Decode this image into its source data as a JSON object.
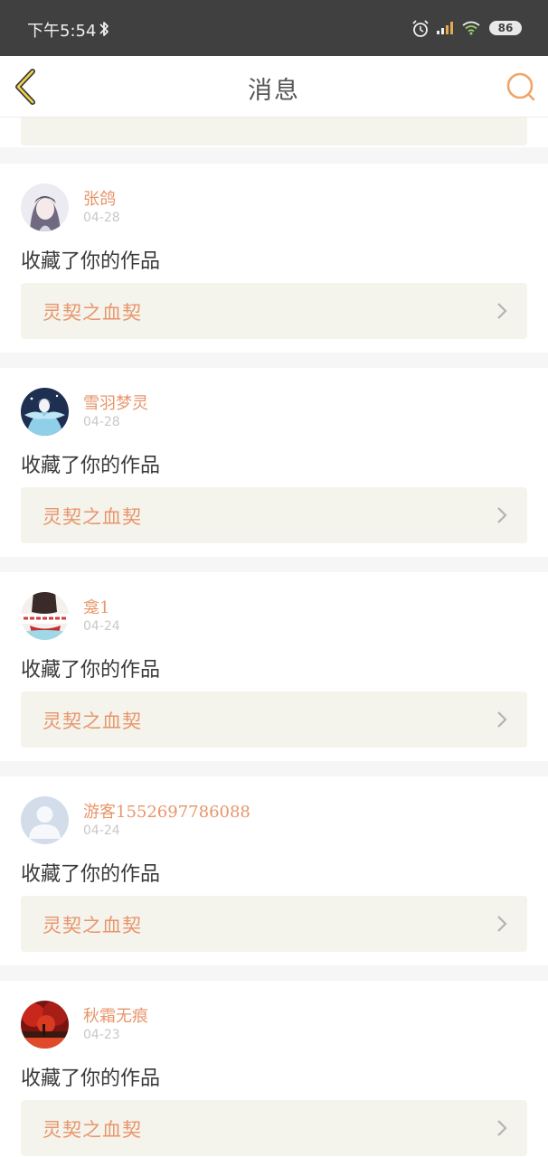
{
  "status_bar": {
    "time": "下午5:54",
    "battery": "86"
  },
  "nav": {
    "title": "消息"
  },
  "messages": [
    {
      "user": "张鸽",
      "date": "04-28",
      "action": "收藏了你的作品",
      "work": "灵契之血契"
    },
    {
      "user": "雪羽梦灵",
      "date": "04-28",
      "action": "收藏了你的作品",
      "work": "灵契之血契"
    },
    {
      "user": "龛1",
      "date": "04-24",
      "action": "收藏了你的作品",
      "work": "灵契之血契"
    },
    {
      "user": "游客1552697786088",
      "date": "04-24",
      "action": "收藏了你的作品",
      "work": "灵契之血契"
    },
    {
      "user": "秋霜无痕",
      "date": "04-23",
      "action": "收藏了你的作品",
      "work": "灵契之血契"
    }
  ],
  "colors": {
    "accent": "#e8956a",
    "status_bar_bg": "#404040",
    "link_bg": "#f4f3ec"
  }
}
